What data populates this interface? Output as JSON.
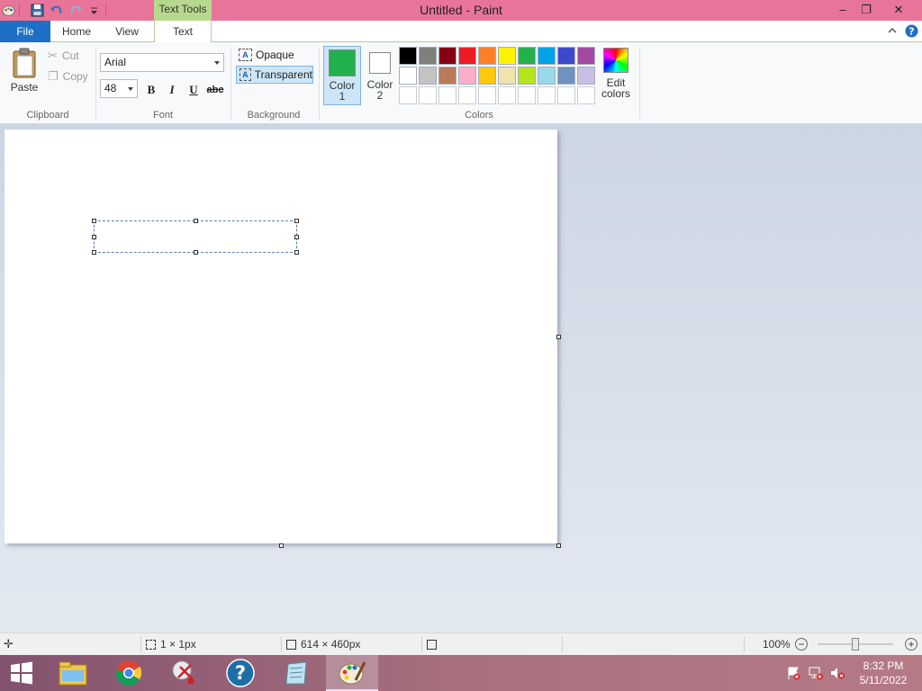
{
  "window": {
    "title": "Untitled - Paint",
    "context_tab": "Text Tools",
    "controls": {
      "minimize": "–",
      "restore": "❐",
      "close": "✕"
    }
  },
  "tabs": [
    {
      "label": "File"
    },
    {
      "label": "Home"
    },
    {
      "label": "View"
    },
    {
      "label": "Text"
    }
  ],
  "ribbon": {
    "clipboard": {
      "paste": "Paste",
      "cut": "Cut",
      "copy": "Copy",
      "group": "Clipboard"
    },
    "font": {
      "family": "Arial",
      "size": "48",
      "bold": "B",
      "italic": "I",
      "underline": "U",
      "strike": "abc",
      "group": "Font"
    },
    "background": {
      "opaque": "Opaque",
      "transparent": "Transparent",
      "group": "Background"
    },
    "colors": {
      "color1_label": "Color\n1",
      "color1_line1": "Color",
      "color1_line2": "1",
      "color2_line1": "Color",
      "color2_line2": "2",
      "color1": "#22b14c",
      "color2": "#ffffff",
      "edit_line1": "Edit",
      "edit_line2": "colors",
      "group": "Colors",
      "palette": [
        "#000000",
        "#7f7f7f",
        "#880015",
        "#ed1c24",
        "#ff7f27",
        "#fff200",
        "#22b14c",
        "#00a2e8",
        "#3f48cc",
        "#a349a4",
        "#ffffff",
        "#c3c3c3",
        "#b97a57",
        "#ffaec9",
        "#ffc90e",
        "#efe4b0",
        "#b5e61d",
        "#99d9ea",
        "#7092be",
        "#c8bfe7",
        "#ffffff",
        "#ffffff",
        "#ffffff",
        "#ffffff",
        "#ffffff",
        "#ffffff",
        "#ffffff",
        "#ffffff",
        "#ffffff",
        "#ffffff"
      ]
    }
  },
  "status": {
    "selection_size": "1 × 1px",
    "image_size": "614 × 460px",
    "zoom": "100%"
  },
  "taskbar": {
    "time": "8:32 PM",
    "date": "5/11/2022",
    "apps": [
      "start-icon",
      "file-explorer-icon",
      "chrome-icon",
      "snipping-tool-icon",
      "help-icon",
      "notepad-icon",
      "paint-icon"
    ]
  }
}
